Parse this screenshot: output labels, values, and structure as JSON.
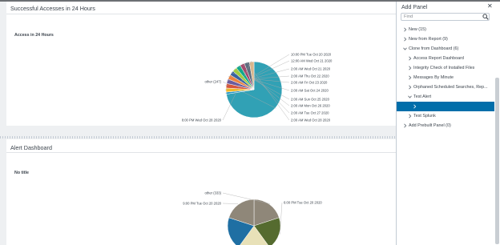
{
  "dashboard": {
    "panels": [
      {
        "title": "Successful Accesses in 24 Hours",
        "subtitle": "Access in 24 Hours",
        "chart_data": {
          "type": "pie",
          "slices": [
            {
              "label": "other (247)",
              "value": 247,
              "color": "#31a1b5"
            },
            {
              "label": "10:00 PM Tue Oct 20 2020",
              "value": 4,
              "color": "#1e93c6"
            },
            {
              "label": "12:00 AM Wed Oct 21 2020",
              "value": 8,
              "color": "#f2b827"
            },
            {
              "label": "2:00 AM Wed Oct 21 2020",
              "value": 9,
              "color": "#d6563c"
            },
            {
              "label": "2:00 AM Thu Oct 22 2020",
              "value": 9,
              "color": "#6a5c9e"
            },
            {
              "label": "2:00 AM Fri Oct 23 2020",
              "value": 9,
              "color": "#ed8440"
            },
            {
              "label": "2:00 AM Sat Oct 24 2020",
              "value": 9,
              "color": "#3863a0"
            },
            {
              "label": "2:00 AM Sun Oct 25 2020",
              "value": 9,
              "color": "#a2cc3e"
            },
            {
              "label": "2:00 AM Mon Oct 26 2020",
              "value": 9,
              "color": "#11a88b"
            },
            {
              "label": "2:00 AM Tue Oct 27 2020",
              "value": 9,
              "color": "#a34b6e"
            },
            {
              "label": "2:00 AM Wed Oct 28 2020",
              "value": 10,
              "color": "#5c6d7e"
            },
            {
              "label": "8:00 PM Wed Oct 28 2020",
              "value": 9,
              "color": "#d9b68c"
            }
          ]
        }
      },
      {
        "title": "Alert Dashboard",
        "subtitle": "No title",
        "chart_data": {
          "type": "pie",
          "slices": [
            {
              "label": "other (333)",
              "value": 333,
              "color": "#8f8779"
            },
            {
              "label": "6:00 PM Tue Oct 20 2020",
              "value": 333,
              "color": "#556b2f"
            },
            {
              "label": "",
              "value": 333,
              "color": "#e8e1b8"
            },
            {
              "label": "",
              "value": 333,
              "color": "#1f6fa3"
            },
            {
              "label": "9:00 PM Tue Oct 20 2020",
              "value": 333,
              "color": "#8f8779"
            }
          ]
        }
      }
    ]
  },
  "add_panel": {
    "title": "Add Panel",
    "close_glyph": "✕",
    "search_placeholder": "Find",
    "items": [
      {
        "label": "New (15)",
        "indent": 0,
        "expanded": false,
        "selected": false
      },
      {
        "label": "New from Report (9)",
        "indent": 0,
        "expanded": false,
        "selected": false
      },
      {
        "label": "Clone from Dashboard (6)",
        "indent": 0,
        "expanded": true,
        "selected": false
      },
      {
        "label": "Access Report Dashboard",
        "indent": 1,
        "expanded": false,
        "selected": false
      },
      {
        "label": "Integrity Check of Installed Files",
        "indent": 1,
        "expanded": false,
        "selected": false
      },
      {
        "label": "Messages By Minute",
        "indent": 1,
        "expanded": false,
        "selected": false
      },
      {
        "label": "Orphaned Scheduled Searches, Rep...",
        "indent": 1,
        "expanded": false,
        "selected": false
      },
      {
        "label": "Test Alert",
        "indent": 1,
        "expanded": true,
        "selected": false
      },
      {
        "label": "",
        "indent": 2,
        "expanded": false,
        "selected": true
      },
      {
        "label": "Test Splunk",
        "indent": 1,
        "expanded": false,
        "selected": false
      },
      {
        "label": "Add Prebuilt Panel (0)",
        "indent": 0,
        "expanded": false,
        "selected": false
      }
    ]
  }
}
